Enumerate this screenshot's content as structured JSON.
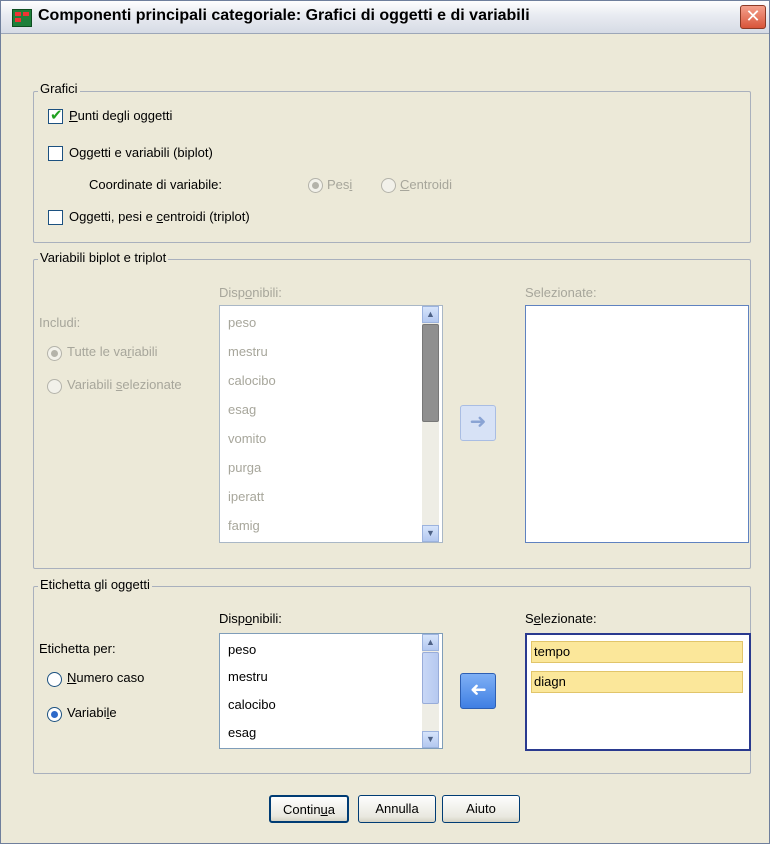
{
  "window": {
    "title": "Componenti principali categoriale: Grafici di oggetti e di variabili",
    "close_glyph": "✕"
  },
  "grafici": {
    "group_title": "Grafici",
    "punti_oggetti": {
      "label_pre": "",
      "label_u": "P",
      "label_post": "unti degli oggetti",
      "checked": true
    },
    "biplot": {
      "label_pre": "O",
      "label_u": "g",
      "label_post": "getti e variabili (biplot)",
      "checked": false
    },
    "coord_label": "Coordinate di variabile:",
    "pesi": {
      "label_pre": "Pes",
      "label_u": "i",
      "label_post": "",
      "selected": true
    },
    "centroidi": {
      "label_pre": "",
      "label_u": "C",
      "label_post": "entroidi",
      "selected": false
    },
    "triplot": {
      "label_pre": "Oggetti, pesi e ",
      "label_u": "c",
      "label_post": "entroidi (triplot)",
      "checked": false
    }
  },
  "variabili": {
    "group_title": "Variabili biplot e triplot",
    "includi_label": "Includi:",
    "tutte": {
      "label_pre": "Tutte le va",
      "label_u": "r",
      "label_post": "iabili",
      "selected": true
    },
    "selezionate_radio": {
      "label_pre": "Variabili ",
      "label_u": "s",
      "label_post": "elezionate",
      "selected": false
    },
    "disponibili_pre": "Disp",
    "disponibili_u": "o",
    "disponibili_post": "nibili:",
    "selezionate_label": "Selezionate:",
    "items": [
      "peso",
      "mestru",
      "calocibo",
      "esag",
      "vomito",
      "purga",
      "iperatt",
      "famig"
    ],
    "move_glyph": "➜"
  },
  "etichetta": {
    "group_title": "Etichetta gli oggetti",
    "per_label": "Etichetta per:",
    "numero": {
      "label_pre": "",
      "label_u": "N",
      "label_post": "umero caso",
      "selected": false
    },
    "variabile": {
      "label_pre": "Variabi",
      "label_u": "l",
      "label_post": "e",
      "selected": true
    },
    "disponibili_pre": "Disp",
    "disponibili_u": "o",
    "disponibili_post": "nibili:",
    "selezionate_pre": "S",
    "selezionate_u": "e",
    "selezionate_post": "lezionate:",
    "items": [
      "peso",
      "mestru",
      "calocibo",
      "esag"
    ],
    "selected_items": [
      "tempo",
      "diagn"
    ],
    "move_glyph": "➜"
  },
  "buttons": {
    "continua_pre": "Contin",
    "continua_u": "u",
    "continua_post": "a",
    "annulla": "Annulla",
    "aiuto": "Aiuto"
  },
  "colors": {
    "accent": "#2f6ac9",
    "selected_fill": "#fbe79a",
    "disabled_text": "#a7a69b"
  }
}
